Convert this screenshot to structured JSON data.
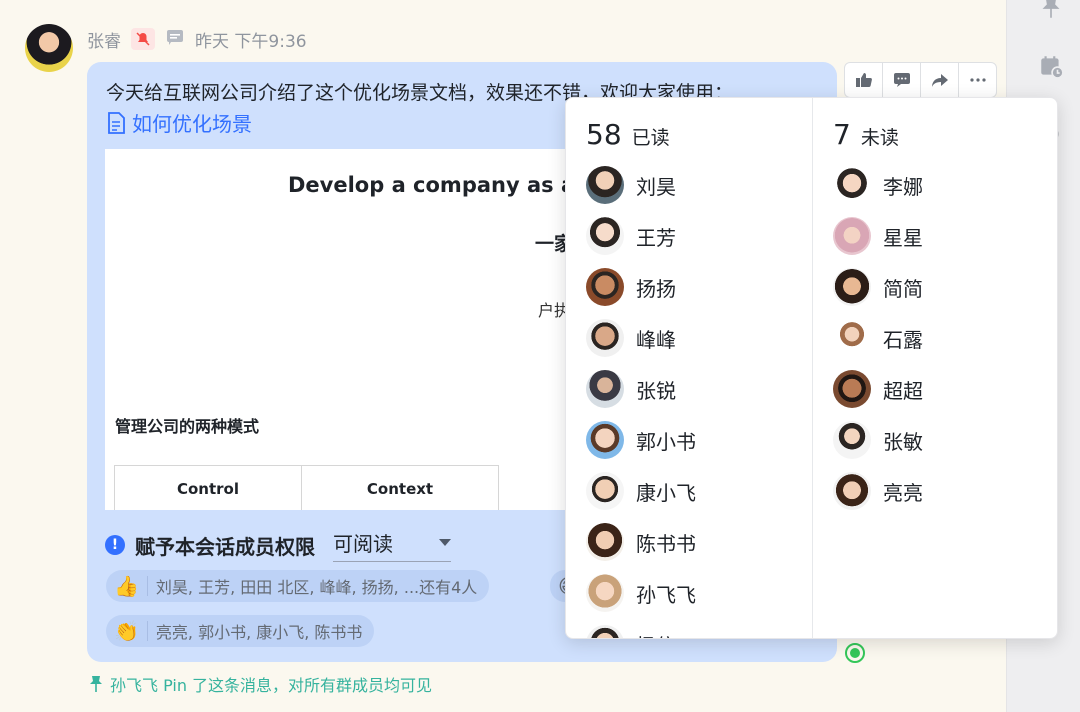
{
  "message": {
    "sender": "张睿",
    "timestamp": "昨天 下午9:36",
    "text": "今天给互联网公司介绍了这个优化场景文档，效果还不错，欢迎大家使用：",
    "doc_link": "如何优化场景"
  },
  "preview": {
    "title": "Develop a company as a pr",
    "subtitle": "一家",
    "small_text": "户执",
    "section_heading": "管理公司的两种模式",
    "table_cols": [
      "Control",
      "Context"
    ]
  },
  "permission": {
    "label": "赋予本会话成员权限",
    "value": "可阅读"
  },
  "reactions": [
    {
      "emoji": "👍",
      "users": "刘昊, 王芳, 田田 北区, 峰峰, 扬扬,  ...还有4人"
    },
    {
      "emoji": "👏",
      "users": "亮亮, 郭小书, 康小飞, 陈书书"
    }
  ],
  "pin_notice": "孙飞飞 Pin 了这条消息，对所有群成员均可见",
  "read_popup": {
    "read_count": "58",
    "read_label": "已读",
    "unread_count": "7",
    "unread_label": "未读",
    "read_users": [
      "刘昊",
      "王芳",
      "扬扬",
      "峰峰",
      "张锐",
      "郭小书",
      "康小飞",
      "陈书书",
      "孙飞飞",
      "杨信"
    ],
    "unread_users": [
      "李娜",
      "星星",
      "简简",
      "石露",
      "超超",
      "张敏",
      "亮亮"
    ]
  },
  "colors": {
    "bubble": "#cfe0fd",
    "link": "#3370ff",
    "pin": "#36b39e",
    "background": "#fbf8ef"
  }
}
